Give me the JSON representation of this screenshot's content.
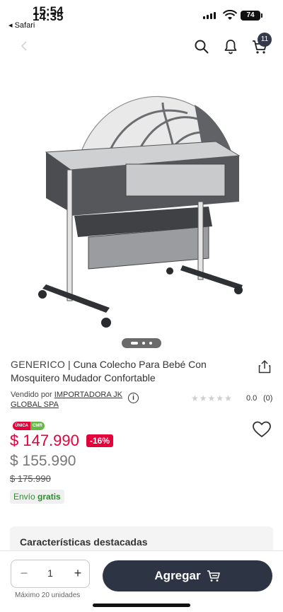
{
  "status_bar": {
    "time_primary": "15:54",
    "time_secondary": "14:35",
    "back_app": "◂ Safari",
    "battery": "74"
  },
  "nav": {
    "cart_count": "11"
  },
  "product": {
    "brand": "GENERICO",
    "separator": " | ",
    "name": "Cuna Colecho Para Bebé Con Mosquitero Mudador Confortable",
    "sold_by_label": "Vendido por ",
    "seller": "IMPORTADORA JK GLOBAL SPA",
    "rating": "0.0",
    "reviews": "(0)"
  },
  "pricing": {
    "badge_unica": "ÚNICA",
    "badge_cmr": "CMR",
    "price_main": "$ 147.990",
    "discount": "-16%",
    "price_secondary": "$ 155.990",
    "price_old": "$ 175.990",
    "shipping_prefix": "Envío ",
    "shipping_bold": "gratis"
  },
  "features": {
    "title": "Características destacadas"
  },
  "purchase": {
    "quantity": "1",
    "max_units": "Máximo 20 unidades",
    "add_label": "Agregar"
  },
  "colors": {
    "accent_red": "#e4003a",
    "button_dark": "#2d3444",
    "shipping_green": "#2e8b2e"
  },
  "icons": {
    "back": "chevron-left-icon",
    "search": "search-icon",
    "bell": "bell-icon",
    "cart": "cart-icon",
    "share": "share-icon",
    "info": "info-icon",
    "heart": "heart-icon"
  }
}
